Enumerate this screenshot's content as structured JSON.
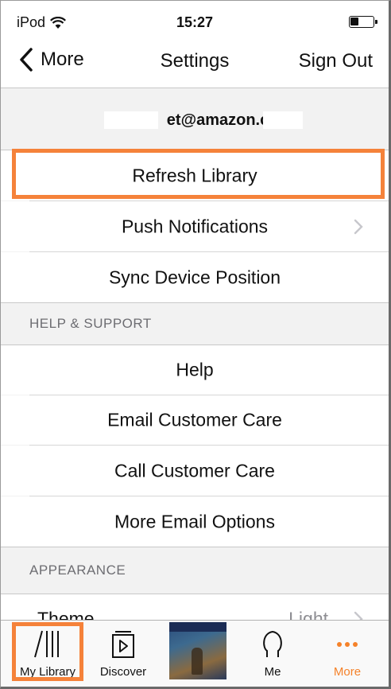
{
  "status_bar": {
    "carrier": "iPod",
    "time": "15:27"
  },
  "nav": {
    "back_label": "More",
    "title": "Settings",
    "sign_out_label": "Sign Out"
  },
  "account": {
    "email_visible": "et@amazon.c"
  },
  "rows_main": [
    {
      "label": "Refresh Library"
    },
    {
      "label": "Push Notifications"
    },
    {
      "label": "Sync Device Position"
    }
  ],
  "help_section": {
    "header": "HELP & SUPPORT",
    "rows": [
      {
        "label": "Help"
      },
      {
        "label": "Email Customer Care"
      },
      {
        "label": "Call Customer Care"
      },
      {
        "label": "More Email Options"
      }
    ]
  },
  "appearance_section": {
    "header": "APPEARANCE",
    "theme_label": "Theme",
    "theme_value": "Light"
  },
  "tabbar": {
    "tabs": [
      {
        "label": "My Library",
        "icon": "library-icon"
      },
      {
        "label": "Discover",
        "icon": "discover-icon"
      },
      {
        "label": "",
        "icon": "now-playing-cover"
      },
      {
        "label": "Me",
        "icon": "me-icon"
      },
      {
        "label": "More",
        "icon": "more-icon"
      }
    ]
  },
  "colors": {
    "accent": "#f5822a",
    "highlight_outline": "#f5823a"
  }
}
